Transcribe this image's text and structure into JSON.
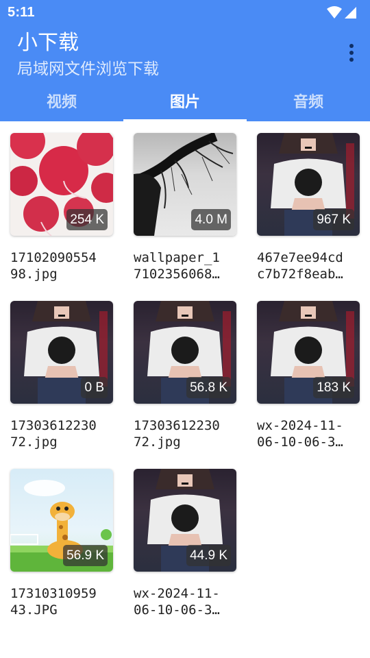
{
  "status_bar": {
    "time": "5:11"
  },
  "app": {
    "title": "小下载",
    "subtitle": "局域网文件浏览下载"
  },
  "tabs": [
    {
      "label": "视频",
      "active": false
    },
    {
      "label": "图片",
      "active": true
    },
    {
      "label": "音频",
      "active": false
    }
  ],
  "files": [
    {
      "size": "254 K",
      "name_line1": "17102090554",
      "name_line2": "98.jpg",
      "art": "radish"
    },
    {
      "size": "4.0 M",
      "name_line1": "wallpaper_1",
      "name_line2": "7102356068…",
      "art": "tree"
    },
    {
      "size": "967 K",
      "name_line1": "467e7ee94cd",
      "name_line2": "c7b72f8eab…",
      "art": "girl"
    },
    {
      "size": "0 B",
      "name_line1": "17303612230",
      "name_line2": "72.jpg",
      "art": "girl"
    },
    {
      "size": "56.8 K",
      "name_line1": "17303612230",
      "name_line2": "72.jpg",
      "art": "girl"
    },
    {
      "size": "183 K",
      "name_line1": "wx-2024-11-",
      "name_line2": "06-10-06-3…",
      "art": "girl"
    },
    {
      "size": "56.9 K",
      "name_line1": "17310310959",
      "name_line2": "43.JPG",
      "art": "giraffe"
    },
    {
      "size": "44.9 K",
      "name_line1": "wx-2024-11-",
      "name_line2": "06-10-06-3…",
      "art": "girl"
    }
  ],
  "colors": {
    "primary": "#4A8BF5",
    "menu_dots": "#0F2F66"
  }
}
